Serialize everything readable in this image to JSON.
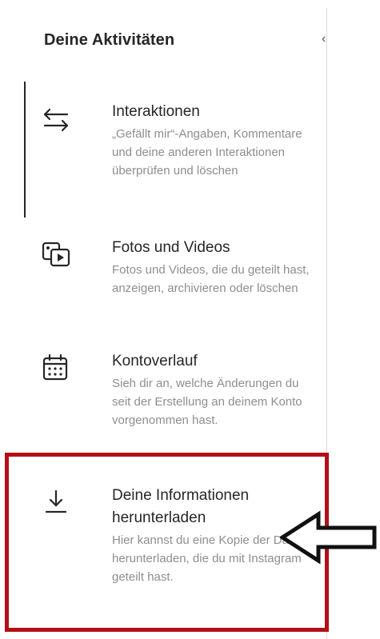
{
  "panel": {
    "title": "Deine Aktivitäten",
    "header_glyph": "‹"
  },
  "items": [
    {
      "icon": "interactions-arrows-icon",
      "title": "Interaktionen",
      "description": "„Gefällt mir“-Angaben, Kommentare und deine anderen Interaktionen überprüfen und löschen",
      "active": true
    },
    {
      "icon": "photos-videos-icon",
      "title": "Fotos und Videos",
      "description": "Fotos und Videos, die du geteilt hast, anzeigen, archivieren oder löschen",
      "active": false
    },
    {
      "icon": "calendar-icon",
      "title": "Kontoverlauf",
      "description": "Sieh dir an, welche Änderungen du seit der Erstellung an deinem Konto vorgenommen hast.",
      "active": false
    },
    {
      "icon": "download-icon",
      "title": "Deine Informationen herunterladen",
      "description": "Hier kannst du eine Kopie der Daten herunterladen, die du mit Instagram geteilt hast.",
      "active": false
    }
  ],
  "annotation": {
    "highlight_color": "#b31016",
    "pointer": "arrow-pointer-icon"
  },
  "colors": {
    "text_primary": "#262626",
    "text_secondary": "#8e8e8e",
    "divider": "#dbdbdb"
  }
}
